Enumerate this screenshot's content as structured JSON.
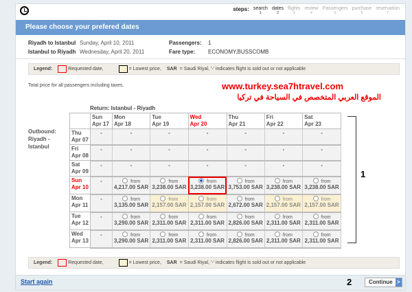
{
  "steps": {
    "label": "steps:",
    "items": [
      {
        "name": "search",
        "n": "1",
        "active": true
      },
      {
        "name": "dates",
        "n": "2",
        "active": true
      },
      {
        "name": "flights",
        "n": "3"
      },
      {
        "name": "review",
        "n": "4"
      },
      {
        "name": "Passengers",
        "n": "5"
      },
      {
        "name": "purchase",
        "n": "6"
      },
      {
        "name": "reservation",
        "n": "7"
      }
    ]
  },
  "title": "Please choose your prefered dates",
  "info": {
    "out_route": "Riyadh to Istanbul",
    "out_date": "Sunday, April 10, 2011",
    "ret_route": "Istanbul to Riyadh",
    "ret_date": "Wednesday, April 20, 2011",
    "pax_label": "Passengers:",
    "pax": "1",
    "fare_label": "Fare type:",
    "fare": "ECONOMY,BUSSCOMB"
  },
  "legend": {
    "label": "Legend:",
    "requested": "Requested date,",
    "lowest": "= Lowest price,",
    "sar": "SAR",
    "sar_desc": "= Saudi Riyal, '-' indicates flight is sold out or not applicable"
  },
  "total_note": "Total price for all passengers including taxes.",
  "watermark": {
    "url": "www.turkey.sea7htravel.com",
    "arabic": "الموقع العربي المتخصص في السياحة في تركيا"
  },
  "return_label": "Return: Istanbul - Riyadh",
  "outbound_label": [
    "Outbound:",
    "Riyadh -",
    "Istanbul"
  ],
  "columns": [
    {
      "d": "Sun",
      "m": "Apr 17"
    },
    {
      "d": "Mon",
      "m": "Apr 18"
    },
    {
      "d": "Tue",
      "m": "Apr 19"
    },
    {
      "d": "Wed",
      "m": "Apr 20",
      "req": true
    },
    {
      "d": "Thu",
      "m": "Apr 21"
    },
    {
      "d": "Fri",
      "m": "Apr 22"
    },
    {
      "d": "Sat",
      "m": "Apr 23"
    }
  ],
  "from_label": "from",
  "rows": [
    {
      "d": "Thu",
      "m": "Apr 07",
      "cells": [
        "-",
        "-",
        "-",
        "-",
        "-",
        "-",
        "-"
      ]
    },
    {
      "d": "Fri",
      "m": "Apr 08",
      "cells": [
        "-",
        "-",
        "-",
        "-",
        "-",
        "-",
        "-"
      ]
    },
    {
      "d": "Sat",
      "m": "Apr 09",
      "cells": [
        "-",
        "-",
        "-",
        "-",
        "-",
        "-",
        "-"
      ]
    },
    {
      "d": "Sun",
      "m": "Apr 10",
      "req": true,
      "cells": [
        "-",
        "4,217.00 SAR",
        "3,238.00 SAR",
        "3,238.00 SAR",
        "3,753.00 SAR",
        "3,238.00 SAR",
        "3,238.00 SAR"
      ],
      "selected": 3
    },
    {
      "d": "Mon",
      "m": "Apr 11",
      "cells": [
        "-",
        "3,135.00 SAR",
        "2,157.00 SAR",
        "2,157.00 SAR",
        "2,672.00 SAR",
        "2,157.00 SAR",
        "2,157.00 SAR"
      ],
      "lowest": [
        2,
        3,
        5,
        6
      ]
    },
    {
      "d": "Tue",
      "m": "Apr 12",
      "cells": [
        "-",
        "3,290.00 SAR",
        "2,311.00 SAR",
        "2,311.00 SAR",
        "2,826.00 SAR",
        "2,311.00 SAR",
        "2,311.00 SAR"
      ]
    },
    {
      "d": "Wed",
      "m": "Apr 13",
      "cells": [
        "-",
        "3,290.00 SAR",
        "2,311.00 SAR",
        "2,311.00 SAR",
        "2,826.00 SAR",
        "2,311.00 SAR",
        "2,311.00 SAR"
      ]
    }
  ],
  "annotation1": "1",
  "annotation2": "2",
  "footer": {
    "start_again": "Start again",
    "continue": "Continue",
    "continue_arrow": ">"
  },
  "colors": {
    "header": "#6b9bd2",
    "requested": "#ee0000",
    "lowest": "#fbf1d2"
  }
}
